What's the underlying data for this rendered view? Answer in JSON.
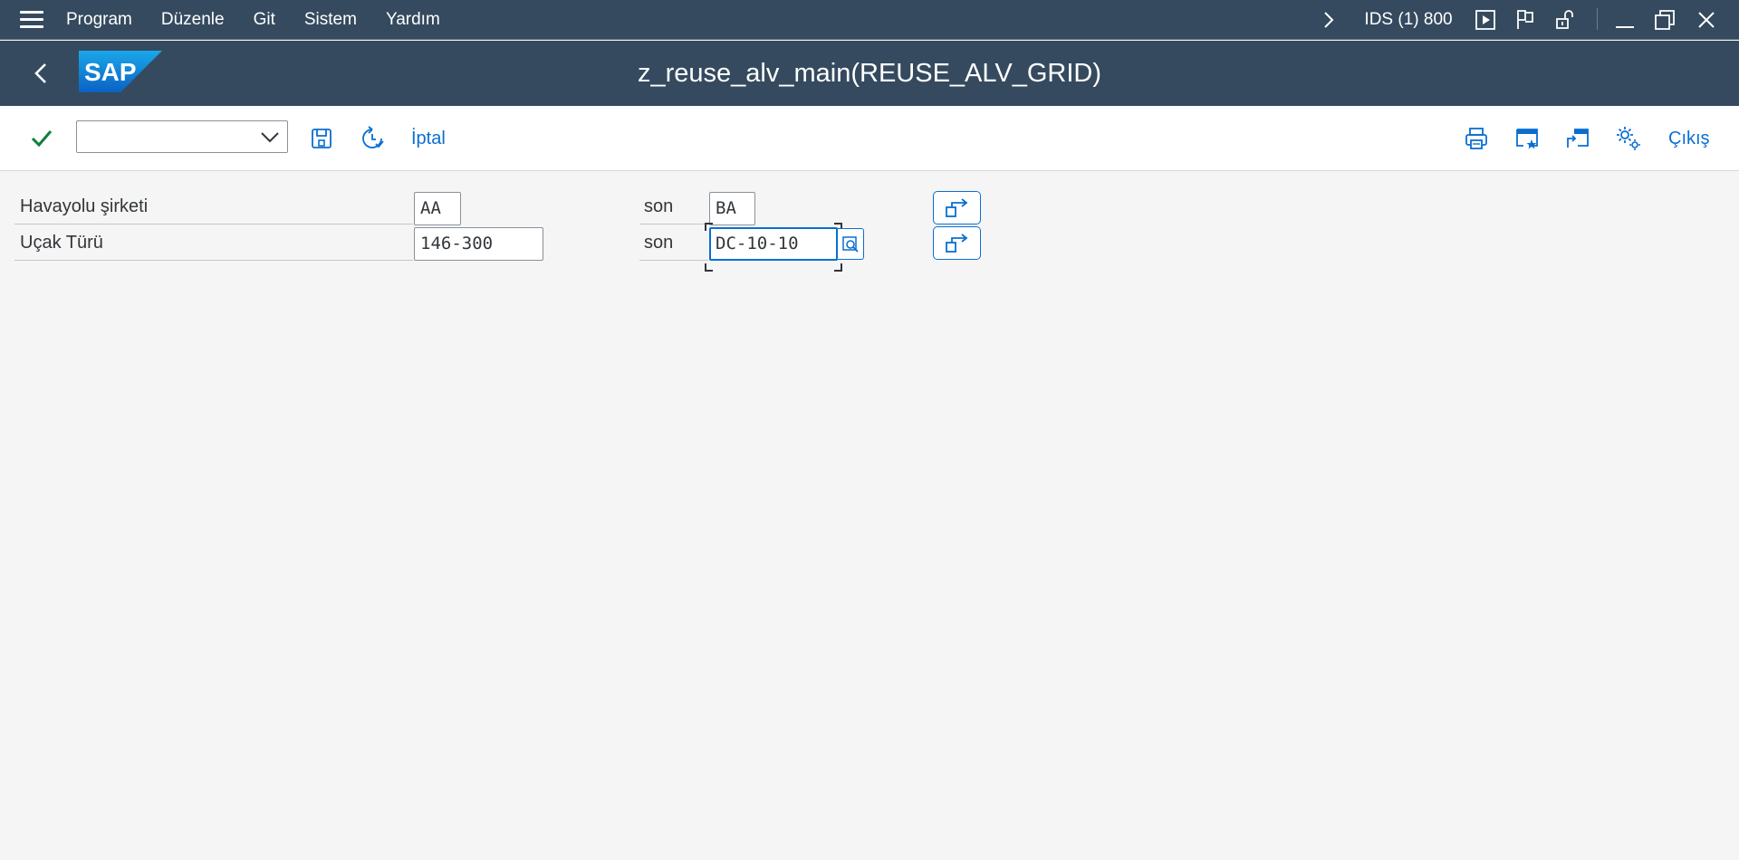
{
  "menubar": {
    "items": [
      {
        "label": "Program"
      },
      {
        "label": "Düzenle"
      },
      {
        "label": "Git"
      },
      {
        "label": "Sistem"
      },
      {
        "label": "Yardım"
      }
    ],
    "system_info": "IDS (1) 800"
  },
  "titlebar": {
    "logo_text": "SAP",
    "title": "z_reuse_alv_main(REUSE_ALV_GRID)"
  },
  "toolbar": {
    "command_field_value": "",
    "cancel_label": "İptal",
    "exit_label": "Çıkış"
  },
  "selection": {
    "rows": [
      {
        "label": "Havayolu şirketi",
        "low": "AA",
        "to_label": "son",
        "high": "BA"
      },
      {
        "label": "Uçak Türü",
        "low": "146-300",
        "to_label": "son",
        "high": "DC-10-10"
      }
    ]
  },
  "colors": {
    "shell_header": "#354a5f",
    "accent": "#0a6ed1",
    "check_green": "#107e3e",
    "background": "#f5f5f5"
  }
}
